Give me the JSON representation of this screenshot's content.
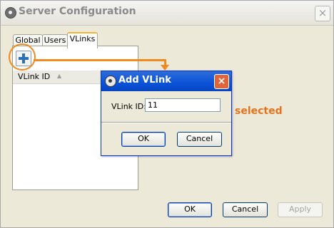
{
  "window": {
    "title": "Server Configuration",
    "close_glyph": "×",
    "app_icon": "app-icon"
  },
  "tabs": [
    {
      "label": "Global",
      "active": false
    },
    {
      "label": "Users",
      "active": false
    },
    {
      "label": "VLinks",
      "active": true
    }
  ],
  "toolbar": {
    "add_icon": "plus-icon"
  },
  "list": {
    "column": "VLink ID",
    "sort_glyph": "▲"
  },
  "footer": {
    "ok": "OK",
    "cancel": "Cancel",
    "apply": "Apply"
  },
  "dialog": {
    "title": "Add VLink",
    "close_glyph": "×",
    "field_label": "VLink ID:",
    "field_value": "11",
    "ok": "OK",
    "cancel": "Cancel"
  },
  "annotation": {
    "text": "selected",
    "color": "#e2741e"
  },
  "colors": {
    "accent": "#f08a1f",
    "dialog_title": "#0a53d8",
    "tab_highlight": "#f6b233"
  }
}
